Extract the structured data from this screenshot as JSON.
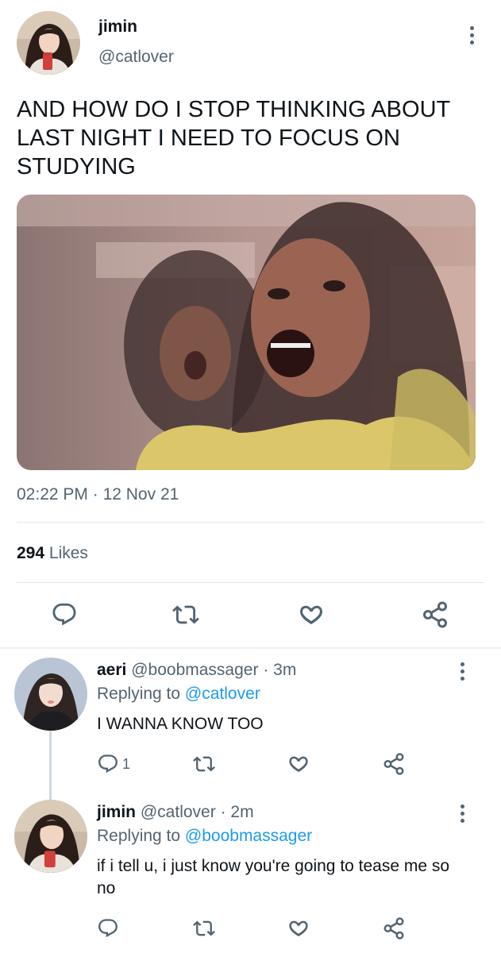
{
  "main_tweet": {
    "display_name": "jimin",
    "handle": "@catlover",
    "text": "AND HOW DO I STOP THINKING ABOUT LAST NIGHT I NEED TO FOCUS ON STUDYING",
    "time": "02:22 PM",
    "date": "12 Nov 21",
    "likes_count": "294",
    "likes_label": "Likes",
    "actions": [
      "reply-icon",
      "retweet-icon",
      "like-icon",
      "share-icon"
    ]
  },
  "replies": [
    {
      "display_name": "aeri",
      "handle": "@boobmassager",
      "time": "3m",
      "replying_label": "Replying to",
      "replying_to": "@catlover",
      "text": "I WANNA KNOW TOO",
      "reply_count": "1"
    },
    {
      "display_name": "jimin",
      "handle": "@catlover",
      "time": "2m",
      "replying_label": "Replying to",
      "replying_to": "@boobmassager",
      "text": "if i tell u, i just know you're going to tease me so no",
      "reply_count": ""
    }
  ],
  "separators": {
    "dot": "·"
  },
  "colors": {
    "text_primary": "#0f1419",
    "text_secondary": "#536471",
    "link": "#1d9bf0",
    "divider": "#e1e5e8"
  }
}
